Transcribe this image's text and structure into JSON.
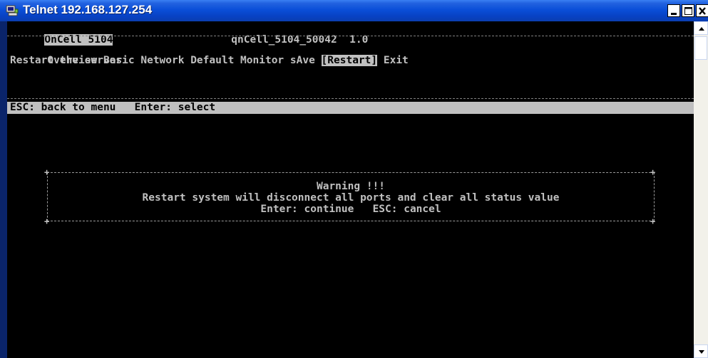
{
  "window": {
    "title": "Telnet 192.168.127.254",
    "icon": "telnet-terminal-icon",
    "controls": {
      "minimize": "minimize-icon",
      "maximize": "maximize-icon",
      "close": "close-icon"
    }
  },
  "console": {
    "header": {
      "model": "OnCell 5104",
      "name": "qnCell_5104_50042",
      "version": "1.0"
    },
    "menu": [
      {
        "label": "Overview",
        "selected": false
      },
      {
        "label": "Basic",
        "selected": false
      },
      {
        "label": "Network",
        "selected": false
      },
      {
        "label": "Default",
        "selected": false
      },
      {
        "label": "Monitor",
        "selected": false
      },
      {
        "label": "sAve",
        "selected": false
      },
      {
        "label": "[Restart]",
        "selected": true
      },
      {
        "label": "Exit",
        "selected": false
      }
    ],
    "menu_description": "Restart the server",
    "status_bar": {
      "esc_hint": "ESC: back to menu",
      "enter_hint": "Enter: select"
    },
    "dialog": {
      "title": "Warning !!!",
      "message": "Restart system will disconnect all ports and clear all status value",
      "continue_hint": "Enter: continue",
      "cancel_hint": "ESC: cancel"
    }
  },
  "colors": {
    "console_bg": "#000000",
    "console_text": "#c0c0c0",
    "highlight_bg": "#c0c0c0",
    "titlebar": "#0a4fd8"
  }
}
